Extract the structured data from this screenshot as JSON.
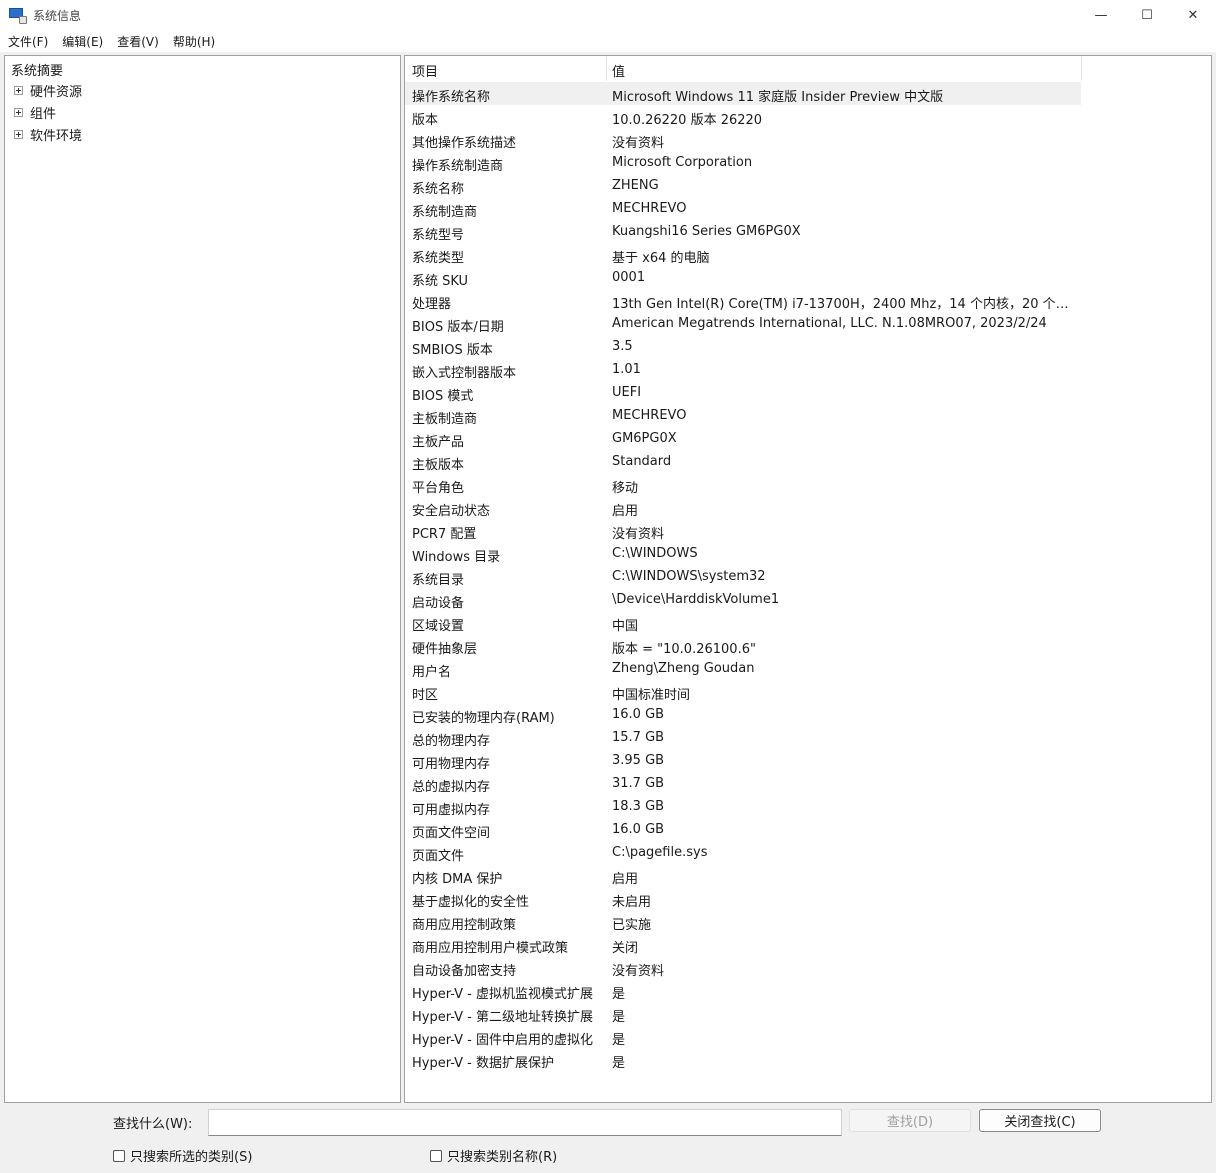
{
  "window": {
    "title": "系统信息",
    "minimize_symbol": "—",
    "maximize_symbol": "☐",
    "close_symbol": "✕"
  },
  "menu": [
    "文件(F)",
    "编辑(E)",
    "查看(V)",
    "帮助(H)"
  ],
  "tree": {
    "root": "系统摘要",
    "nodes": [
      "硬件资源",
      "组件",
      "软件环境"
    ]
  },
  "columns": {
    "item": "项目",
    "value": "值"
  },
  "rows": [
    {
      "item": "操作系统名称",
      "value": "Microsoft Windows 11 家庭版 Insider Preview 中文版"
    },
    {
      "item": "版本",
      "value": "10.0.26220 版本 26220"
    },
    {
      "item": "其他操作系统描述",
      "value": "没有资料"
    },
    {
      "item": "操作系统制造商",
      "value": "Microsoft Corporation"
    },
    {
      "item": "系统名称",
      "value": "ZHENG"
    },
    {
      "item": "系统制造商",
      "value": "MECHREVO"
    },
    {
      "item": "系统型号",
      "value": "Kuangshi16 Series GM6PG0X"
    },
    {
      "item": "系统类型",
      "value": "基于 x64 的电脑"
    },
    {
      "item": "系统 SKU",
      "value": "0001"
    },
    {
      "item": "处理器",
      "value": "13th Gen Intel(R) Core(TM) i7-13700H，2400 Mhz，14 个内核，20 个逻..."
    },
    {
      "item": "BIOS 版本/日期",
      "value": "American Megatrends International, LLC. N.1.08MRO07, 2023/2/24"
    },
    {
      "item": "SMBIOS 版本",
      "value": "3.5"
    },
    {
      "item": "嵌入式控制器版本",
      "value": "1.01"
    },
    {
      "item": "BIOS 模式",
      "value": "UEFI"
    },
    {
      "item": "主板制造商",
      "value": "MECHREVO"
    },
    {
      "item": "主板产品",
      "value": "GM6PG0X"
    },
    {
      "item": "主板版本",
      "value": "Standard"
    },
    {
      "item": "平台角色",
      "value": "移动"
    },
    {
      "item": "安全启动状态",
      "value": "启用"
    },
    {
      "item": "PCR7 配置",
      "value": "没有资料"
    },
    {
      "item": "Windows 目录",
      "value": "C:\\WINDOWS"
    },
    {
      "item": "系统目录",
      "value": "C:\\WINDOWS\\system32"
    },
    {
      "item": "启动设备",
      "value": "\\Device\\HarddiskVolume1"
    },
    {
      "item": "区域设置",
      "value": "中国"
    },
    {
      "item": "硬件抽象层",
      "value": "版本 = \"10.0.26100.6\""
    },
    {
      "item": "用户名",
      "value": "Zheng\\Zheng Goudan"
    },
    {
      "item": "时区",
      "value": "中国标准时间"
    },
    {
      "item": "已安装的物理内存(RAM)",
      "value": "16.0 GB"
    },
    {
      "item": "总的物理内存",
      "value": "15.7 GB"
    },
    {
      "item": "可用物理内存",
      "value": "3.95 GB"
    },
    {
      "item": "总的虚拟内存",
      "value": "31.7 GB"
    },
    {
      "item": "可用虚拟内存",
      "value": "18.3 GB"
    },
    {
      "item": "页面文件空间",
      "value": "16.0 GB"
    },
    {
      "item": "页面文件",
      "value": "C:\\pagefile.sys"
    },
    {
      "item": "内核 DMA 保护",
      "value": "启用"
    },
    {
      "item": "基于虚拟化的安全性",
      "value": "未启用"
    },
    {
      "item": "商用应用控制政策",
      "value": "已实施"
    },
    {
      "item": "商用应用控制用户模式政策",
      "value": "关闭"
    },
    {
      "item": "自动设备加密支持",
      "value": "没有资料"
    },
    {
      "item": "Hyper-V - 虚拟机监视模式扩展",
      "value": "是"
    },
    {
      "item": "Hyper-V - 第二级地址转换扩展",
      "value": "是"
    },
    {
      "item": "Hyper-V - 固件中启用的虚拟化",
      "value": "是"
    },
    {
      "item": "Hyper-V - 数据扩展保护",
      "value": "是"
    }
  ],
  "find": {
    "label": "查找什么(W):",
    "value": "",
    "find_button": "查找(D)",
    "close_find_button": "关闭查找(C)",
    "checkbox_selected_category": "只搜索所选的类别(S)",
    "checkbox_category_names": "只搜索类别名称(R)"
  }
}
